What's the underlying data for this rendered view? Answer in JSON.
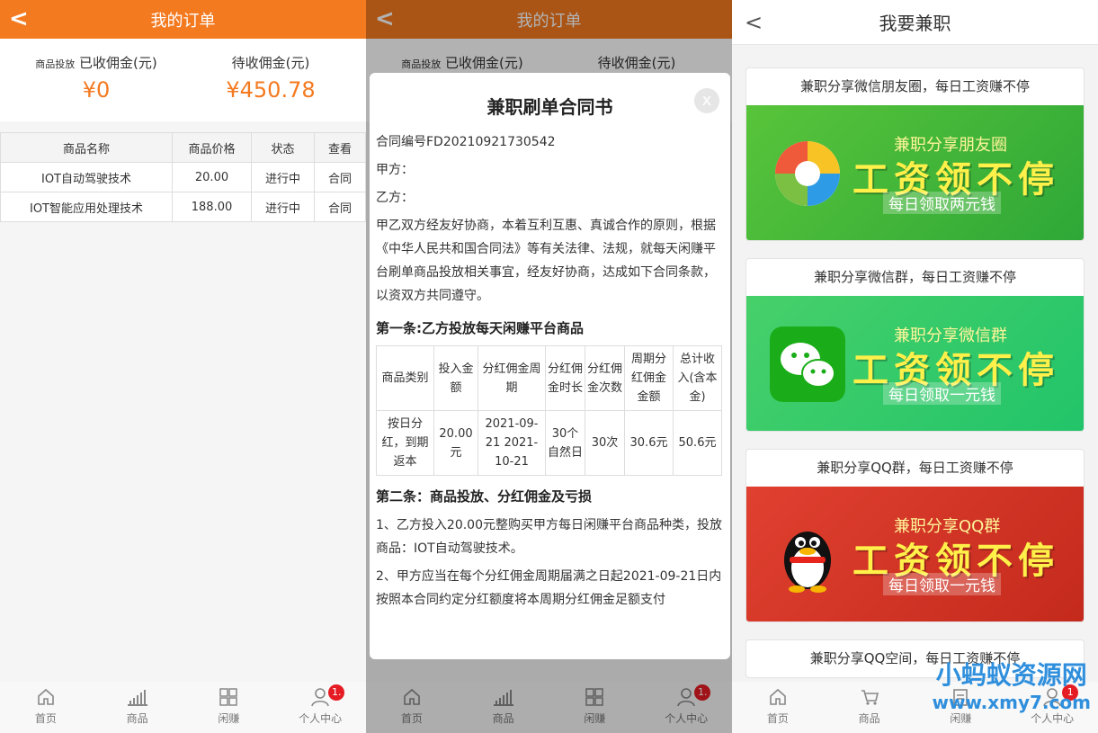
{
  "panel1": {
    "title": "我的订单",
    "received": {
      "tag": "商品投放",
      "label": "已收佣金(元)",
      "value": "¥0"
    },
    "pending": {
      "label": "待收佣金(元)",
      "value": "¥450.78"
    },
    "table": {
      "headers": [
        "商品名称",
        "商品价格",
        "状态",
        "查看"
      ],
      "rows": [
        [
          "IOT自动驾驶技术",
          "20.00",
          "进行中",
          "合同"
        ],
        [
          "IOT智能应用处理技术",
          "188.00",
          "进行中",
          "合同"
        ]
      ]
    }
  },
  "tabbar": {
    "items": [
      "首页",
      "商品",
      "闲赚",
      "个人中心"
    ],
    "badge": "1."
  },
  "tabbar3": {
    "items": [
      "首页",
      "商品",
      "闲赚",
      "个人中心"
    ],
    "badge": "1"
  },
  "modal": {
    "title": "兼职刷单合同书",
    "close": "x",
    "contract_no": "合同编号FD20210921730542",
    "party_a": "甲方：",
    "party_b": "乙方：",
    "intro": "甲乙双方经友好协商，本着互利互惠、真诚合作的原则，根据《中华人民共和国合同法》等有关法律、法规，就每天闲赚平台刷单商品投放相关事宜，经友好协商，达成如下合同条款，以资双方共同遵守。",
    "section1": "第一条:乙方投放每天闲赚平台商品",
    "table_headers": [
      "商品类别",
      "投入金额",
      "分红佣金周期",
      "分红佣金时长",
      "分红佣金次数",
      "周期分红佣金金额",
      "总计收入(含本金)"
    ],
    "table_row": [
      "按日分红，到期返本",
      "20.00元",
      "2021-09-21 2021-10-21",
      "30个自然日",
      "30次",
      "30.6元",
      "50.6元"
    ],
    "section2": "第二条：商品投放、分红佣金及亏损",
    "clause1": "1、乙方投入20.00元整购买甲方每日闲赚平台商品种类，投放商品：IOT自动驾驶技术。",
    "clause2": "2、甲方应当在每个分红佣金周期届满之日起2021-09-21日内按照本合同约定分红额度将本周期分红佣金足额支付"
  },
  "panel3": {
    "title": "我要兼职",
    "cards": [
      {
        "title": "兼职分享微信朋友圈，每日工资赚不停",
        "t1": "兼职分享朋友圈",
        "t2": "工资领不停",
        "t3": "每日领取两元钱",
        "color": "#3fb53c"
      },
      {
        "title": "兼职分享微信群，每日工资赚不停",
        "t1": "兼职分享微信群",
        "t2": "工资领不停",
        "t3": "每日领取一元钱",
        "color": "#2ec95a"
      },
      {
        "title": "兼职分享QQ群，每日工资赚不停",
        "t1": "兼职分享QQ群",
        "t2": "工资领不停",
        "t3": "每日领取一元钱",
        "color": "#d93424"
      },
      {
        "title": "兼职分享QQ空间，每日工资赚不停"
      }
    ],
    "watermark": {
      "line1": "小蚂蚁资源网",
      "line2": "www.xmy7.com"
    }
  }
}
